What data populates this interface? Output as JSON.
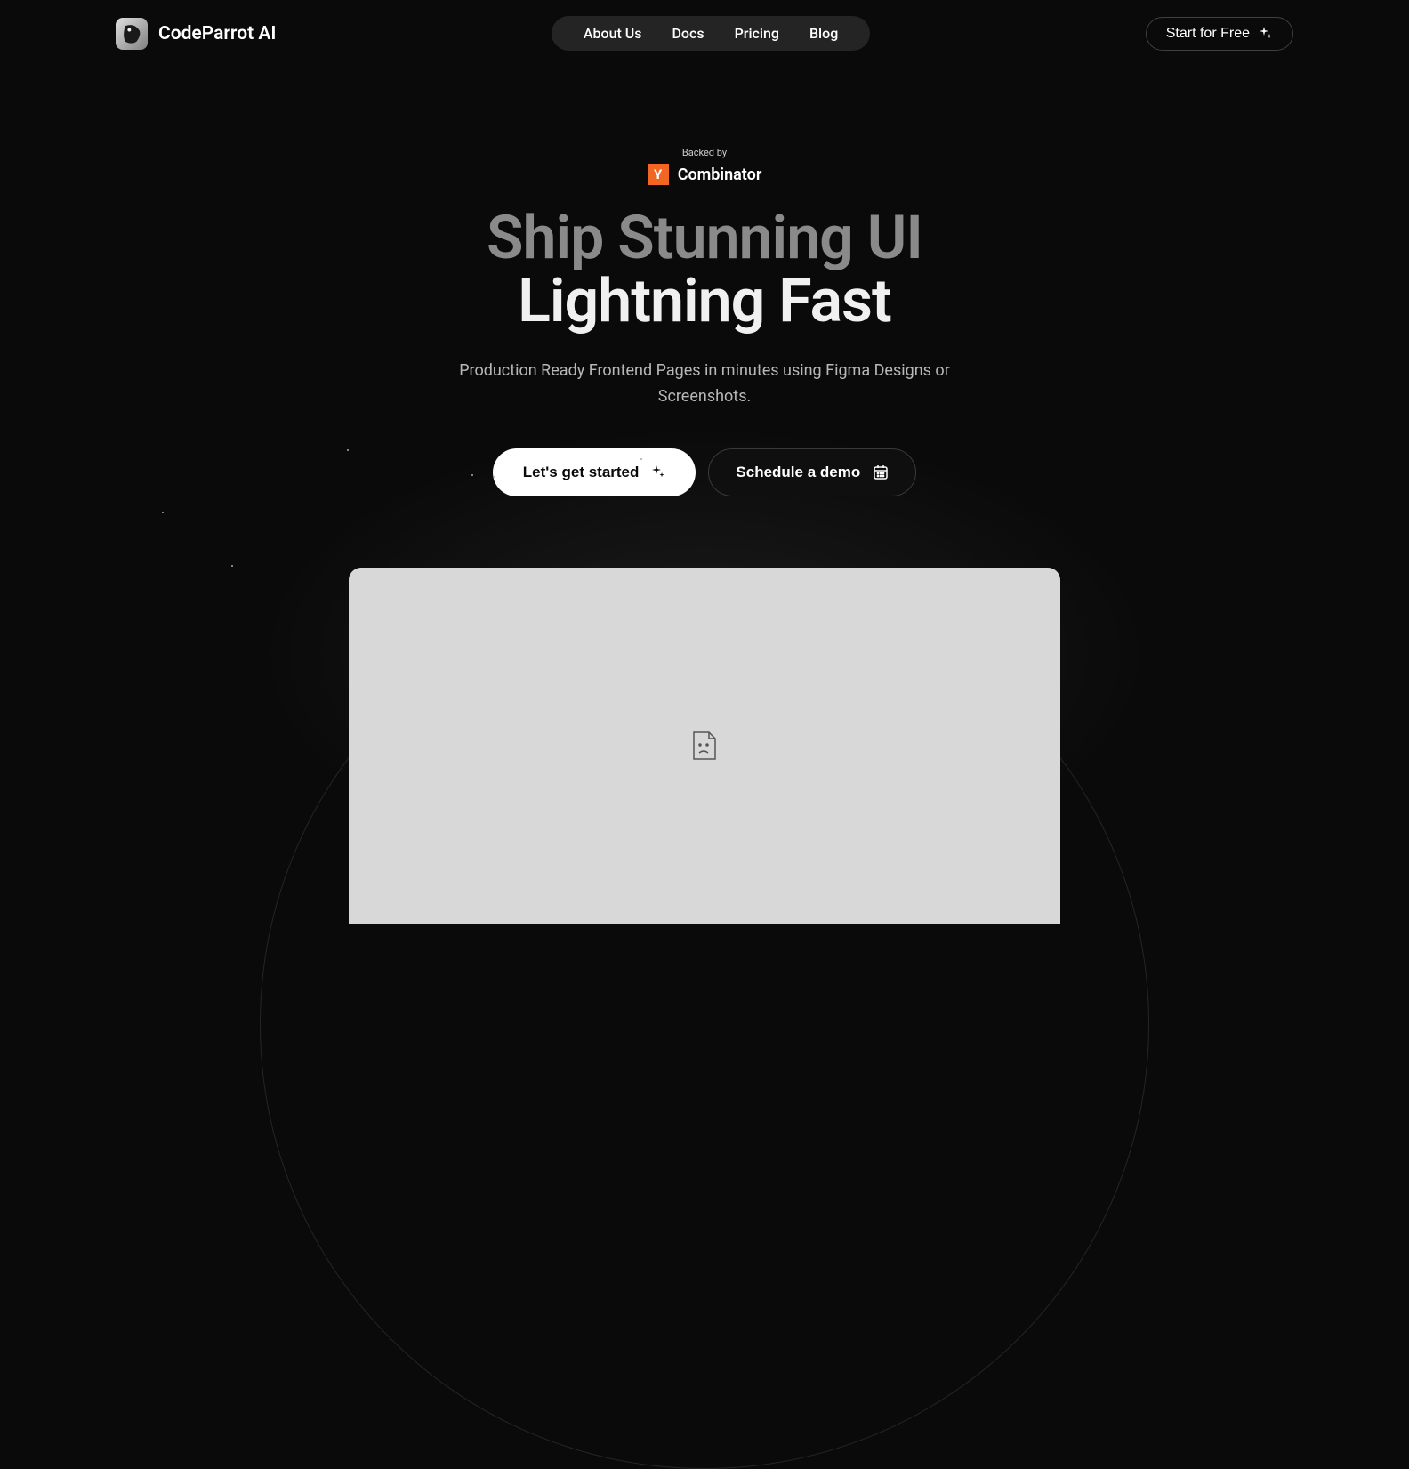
{
  "header": {
    "brand_name": "CodeParrot AI",
    "nav_items": [
      "About Us",
      "Docs",
      "Pricing",
      "Blog"
    ],
    "cta_label": "Start for Free"
  },
  "hero": {
    "backed_by_label": "Backed by",
    "yc_letter": "Y",
    "yc_name": "Combinator",
    "title_line1": "Ship Stunning UI",
    "title_line2": "Lightning Fast",
    "subtitle": "Production Ready Frontend Pages in minutes using Figma Designs or Screenshots.",
    "primary_btn_label": "Let's get started",
    "secondary_btn_label": "Schedule a demo"
  }
}
